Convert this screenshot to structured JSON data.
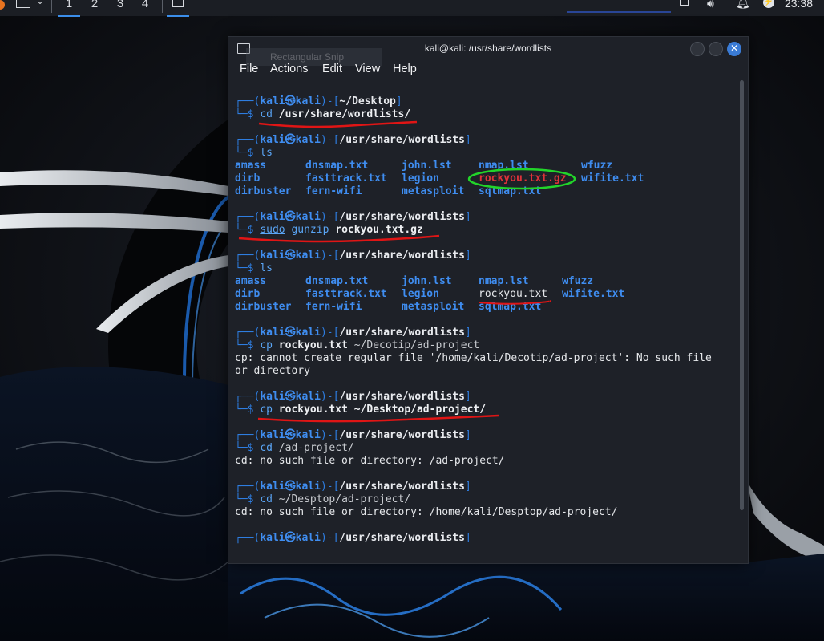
{
  "panel": {
    "workspaces": [
      "1",
      "2",
      "3",
      "4"
    ],
    "active_workspace": "1",
    "clock": "23:38"
  },
  "window": {
    "title": "kali@kali: /usr/share/wordlists",
    "ghost_tooltip": "Rectangular Snip",
    "menu": [
      "File",
      "Actions",
      "Edit",
      "View",
      "Help"
    ]
  },
  "prompt": {
    "frame_open": "┌──(",
    "user": "kali㉿kali",
    "frame_mid": ")-[",
    "frame_close": "]",
    "corner": "└─$"
  },
  "terminal": {
    "blocks": [
      {
        "path": "~/Desktop",
        "cmd": "cd",
        "args": "/usr/share/wordlists/",
        "output": []
      },
      {
        "path": "/usr/share/wordlists",
        "cmd": "ls",
        "args": "",
        "ls_set": "ls1"
      },
      {
        "path": "/usr/share/wordlists",
        "cmd": "sudo gunzip",
        "args": "rockyou.txt.gz",
        "output": []
      },
      {
        "path": "/usr/share/wordlists",
        "cmd": "ls",
        "args": "",
        "ls_set": "ls2"
      },
      {
        "path": "/usr/share/wordlists",
        "cmd": "cp",
        "args": "rockyou.txt ~/Decotip/ad-project",
        "output": [
          "cp: cannot create regular file '/home/kali/Decotip/ad-project': No such file",
          "or directory"
        ]
      },
      {
        "path": "/usr/share/wordlists",
        "cmd": "cp",
        "args": "rockyou.txt ~/Desktop/ad-project/",
        "output": []
      },
      {
        "path": "/usr/share/wordlists",
        "cmd": "cd",
        "args": "/ad-project/",
        "output": [
          "cd: no such file or directory: /ad-project/"
        ]
      },
      {
        "path": "/usr/share/wordlists",
        "cmd": "cd",
        "args": "~/Desptop/ad-project/",
        "output": [
          "cd: no such file or directory: /home/kali/Desptop/ad-project/"
        ]
      },
      {
        "path": "/usr/share/wordlists"
      }
    ],
    "ls1": [
      [
        "amass",
        "dnsmap.txt",
        "john.lst",
        "nmap.lst",
        "wfuzz"
      ],
      [
        "dirb",
        "fasttrack.txt",
        "legion",
        "rockyou.txt.gz",
        "wifite.txt"
      ],
      [
        "dirbuster",
        "fern-wifi",
        "metasploit",
        "sqlmap.txt",
        ""
      ]
    ],
    "ls2": [
      [
        "amass",
        "dnsmap.txt",
        "john.lst",
        "nmap.lst",
        "wfuzz"
      ],
      [
        "dirb",
        "fasttrack.txt",
        "legion",
        "rockyou.txt",
        "wifite.txt"
      ],
      [
        "dirbuster",
        "fern-wifi",
        "metasploit",
        "sqlmap.txt",
        ""
      ]
    ]
  },
  "colors": {
    "prompt_blue": "#2e7de0",
    "annotation_red": "#e01515",
    "annotation_green": "#22d42a",
    "archive_red": "#e0323a"
  }
}
